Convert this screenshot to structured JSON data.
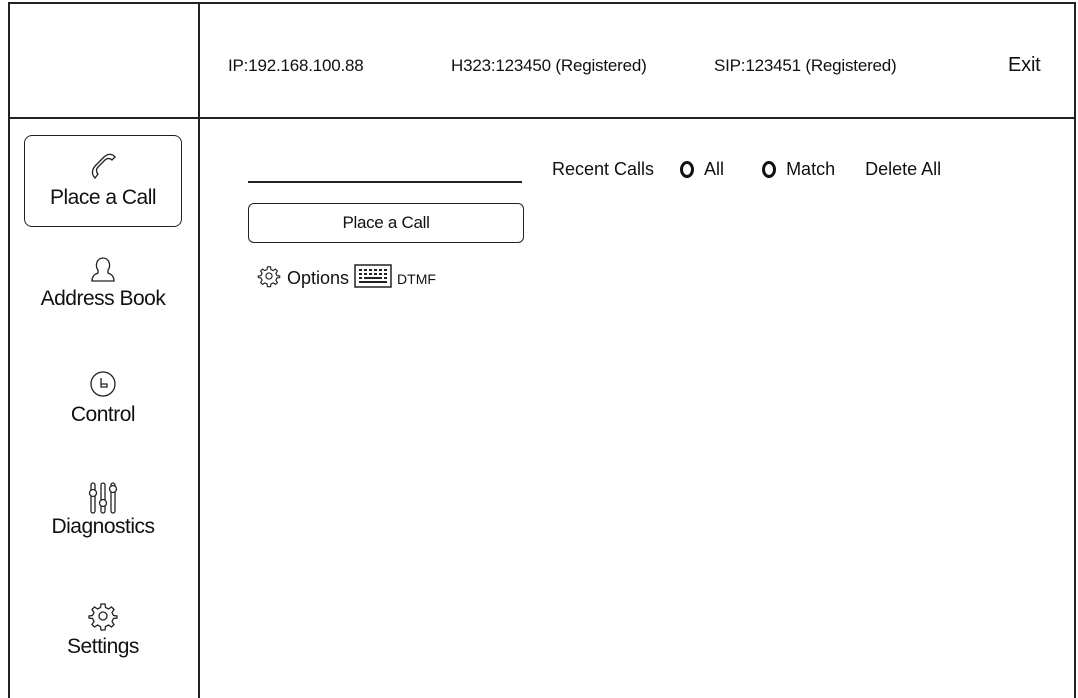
{
  "header": {
    "ip": "IP:192.168.100.88",
    "h323": "H323:123450 (Registered)",
    "sip": "SIP:123451 (Registered)",
    "exit_label": "Exit"
  },
  "sidebar": {
    "items": [
      {
        "label": "Place a Call",
        "icon": "phone-icon",
        "active": true
      },
      {
        "label": "Address Book",
        "icon": "person-icon"
      },
      {
        "label": "Control",
        "icon": "clock-icon"
      },
      {
        "label": "Diagnostics",
        "icon": "sliders-icon"
      },
      {
        "label": "Settings",
        "icon": "gear-icon"
      }
    ]
  },
  "main": {
    "dial_value": "",
    "call_button_label": "Place a Call",
    "options_label": "Options",
    "dtmf_label": "DTMF",
    "recent": {
      "title": "Recent Calls",
      "filter_all": "All",
      "filter_match": "Match",
      "delete_all": "Delete All"
    }
  }
}
